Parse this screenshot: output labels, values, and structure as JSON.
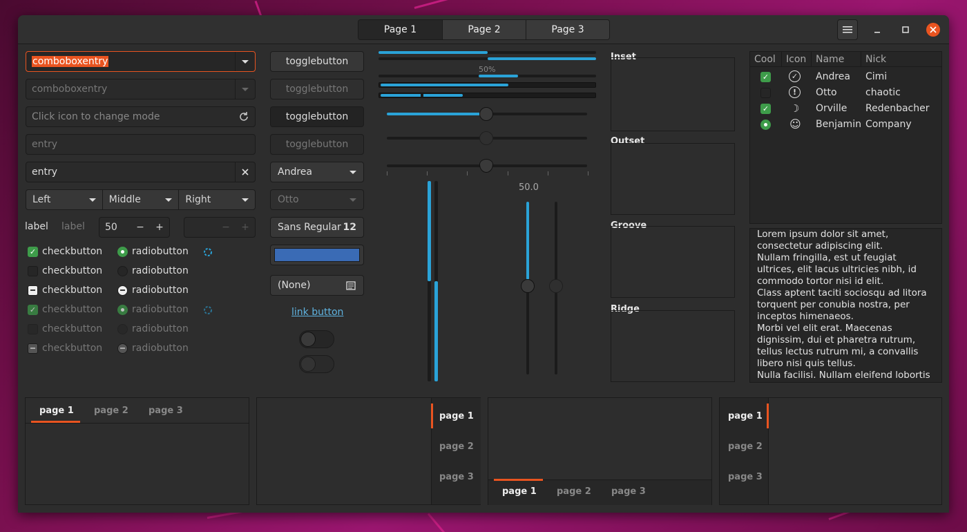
{
  "header": {
    "tabs": [
      "Page 1",
      "Page 2",
      "Page 3"
    ],
    "menu_icon": "hamburger-menu-icon",
    "min_icon": "minimize-icon",
    "max_icon": "maximize-icon",
    "close_icon": "close-icon"
  },
  "col1": {
    "combo_active": "comboboxentry",
    "combo_disabled": "comboboxentry",
    "entry_mode_placeholder": "Click icon to change mode",
    "entry_placeholder": "entry",
    "entry_value": "entry",
    "combos": [
      "Left",
      "Middle",
      "Right"
    ],
    "label1": "label",
    "label2": "label",
    "spin_value": "50",
    "spin_minus": "−",
    "spin_plus": "+",
    "checkbutton": "checkbutton",
    "radiobutton": "radiobutton"
  },
  "col2": {
    "toggle": "togglebutton",
    "combo_andrea": "Andrea",
    "combo_otto": "Otto",
    "font_name": "Sans Regular",
    "font_size": "12",
    "color_hex": "#3a6bb5",
    "file_chooser": "(None)",
    "link": "link button",
    "switch1_on": false,
    "switch2_on": false
  },
  "col3": {
    "progress_label": "50%",
    "progress_values": [
      0.5,
      0.5,
      0.5,
      0.6,
      0.4
    ],
    "scale_values": [
      0.5,
      0.5,
      0.5
    ],
    "vscale_label": "50.0",
    "vscale_value": 0.5
  },
  "frames": [
    "Inset",
    "Outset",
    "Groove",
    "Ridge"
  ],
  "tree": {
    "headers": [
      "Cool",
      "Icon",
      "Name",
      "Nick"
    ],
    "rows": [
      {
        "cool": "check",
        "icon": "check-circle-icon",
        "glyph": "✓",
        "name": "Andrea",
        "nick": "Cimi"
      },
      {
        "cool": "off",
        "icon": "exclamation-circle-icon",
        "glyph": "!",
        "name": "Otto",
        "nick": "chaotic"
      },
      {
        "cool": "check",
        "icon": "weather-night-icon",
        "glyph": "☽",
        "name": "Orville",
        "nick": "Redenbacher"
      },
      {
        "cool": "radio",
        "icon": "face-icon",
        "glyph": "☺",
        "name": "Benjamin",
        "nick": "Company"
      }
    ]
  },
  "textview": [
    "Lorem ipsum dolor sit amet,",
    "consectetur adipiscing elit.",
    "Nullam fringilla, est ut feugiat",
    "ultrices, elit lacus ultricies nibh, id",
    "commodo tortor nisi id elit.",
    "Class aptent taciti sociosqu ad litora",
    "torquent per conubia nostra, per",
    "inceptos himenaeos.",
    "Morbi vel elit erat. Maecenas",
    "dignissim, dui et pharetra rutrum,",
    "tellus lectus rutrum mi, a convallis",
    "libero nisi quis tellus.",
    "Nulla facilisi. Nullam eleifend lobortis"
  ],
  "notebooks": {
    "tabs": [
      "page 1",
      "page 2",
      "page 3"
    ],
    "accent": "#e95420"
  }
}
